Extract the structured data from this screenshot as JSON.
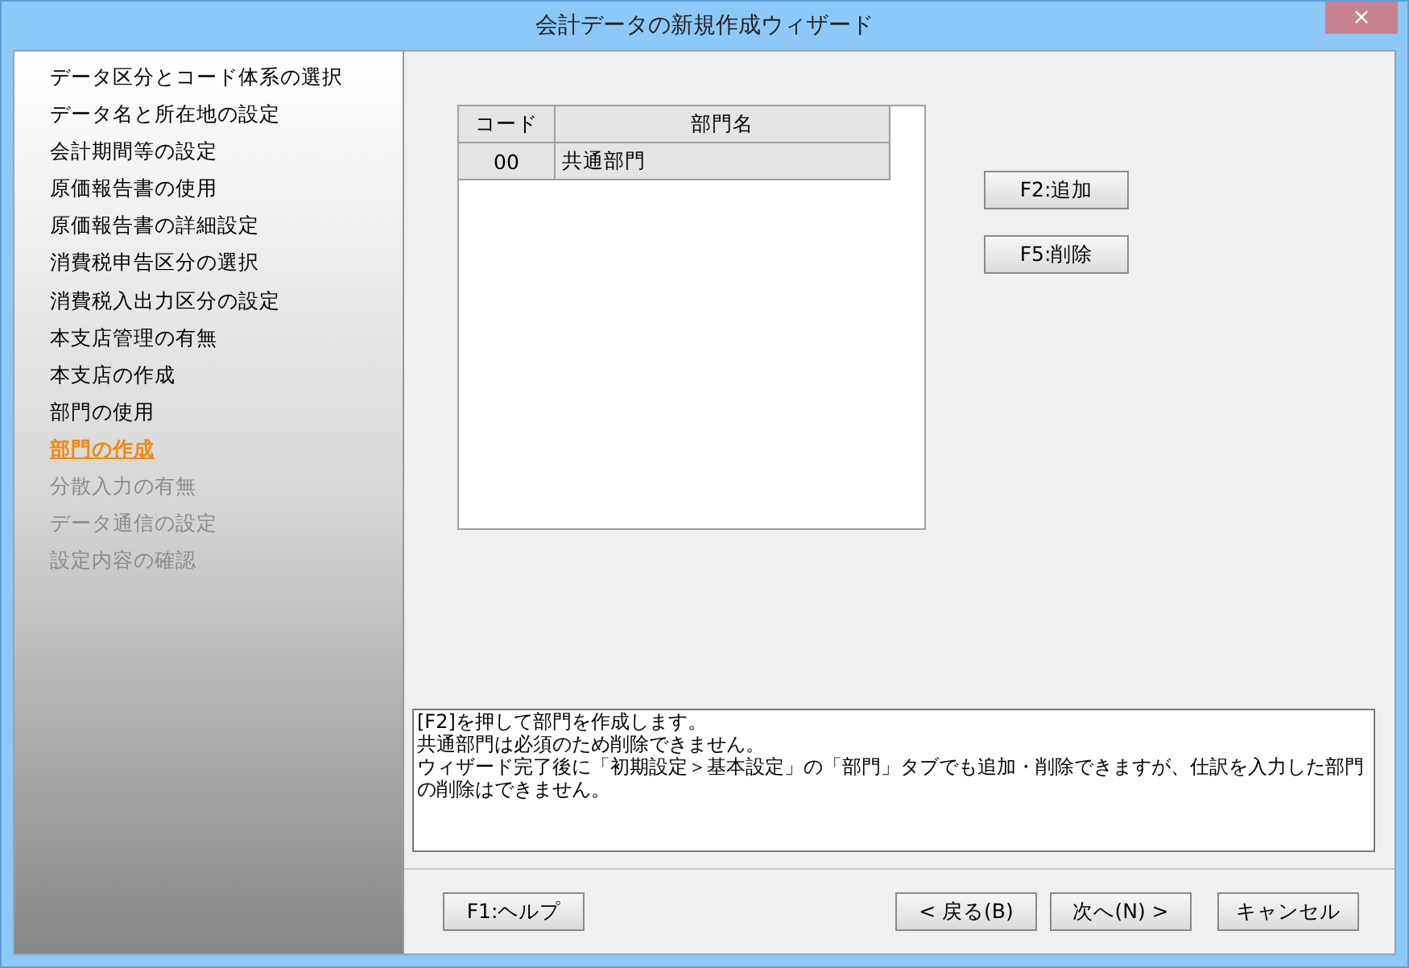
{
  "window": {
    "title": "会計データの新規作成ウィザード",
    "close_label": "×"
  },
  "steps": [
    {
      "label": "データ区分とコード体系の選択",
      "selected": false,
      "disabled": false
    },
    {
      "label": "データ名と所在地の設定",
      "selected": false,
      "disabled": false
    },
    {
      "label": "会計期間等の設定",
      "selected": false,
      "disabled": false
    },
    {
      "label": "原価報告書の使用",
      "selected": false,
      "disabled": false
    },
    {
      "label": "原価報告書の詳細設定",
      "selected": false,
      "disabled": false
    },
    {
      "label": "消費税申告区分の選択",
      "selected": false,
      "disabled": false
    },
    {
      "label": "消費税入出力区分の設定",
      "selected": false,
      "disabled": false
    },
    {
      "label": "本支店管理の有無",
      "selected": false,
      "disabled": false
    },
    {
      "label": "本支店の作成",
      "selected": false,
      "disabled": false
    },
    {
      "label": "部門の使用",
      "selected": false,
      "disabled": false
    },
    {
      "label": "部門の作成",
      "selected": true,
      "disabled": false
    },
    {
      "label": "分散入力の有無",
      "selected": false,
      "disabled": true
    },
    {
      "label": "データ通信の設定",
      "selected": false,
      "disabled": true
    },
    {
      "label": "設定内容の確認",
      "selected": false,
      "disabled": true
    }
  ],
  "table": {
    "columns": [
      "コード",
      "部門名"
    ],
    "rows": [
      [
        "00",
        "共通部門"
      ]
    ]
  },
  "side_buttons": [
    "F2:追加",
    "F5:削除"
  ],
  "description": [
    "[F2]を押して部門を作成します。",
    "共通部門は必須のため削除できません。",
    "ウィザード完了後に「初期設定＞基本設定」の「部門」タブでも追加・削除できますが、仕訳を入力した部門の削除はできません。"
  ],
  "footer": {
    "help": "F1:ヘルプ",
    "back": "< 戻る(B)",
    "next": "次へ(N) >",
    "cancel": "キャンセル"
  }
}
